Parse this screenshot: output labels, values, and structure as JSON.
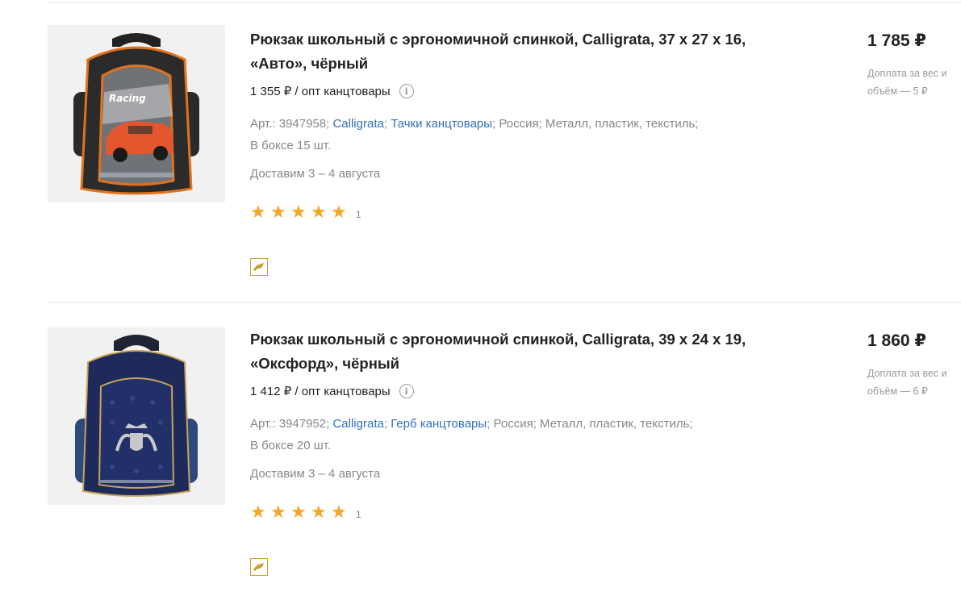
{
  "products": [
    {
      "title_line1": "Рюкзак школьный с эргономичной спинкой, Calligrata, 37 х 27 х 16,",
      "title_line2": "«Авто», чёрный",
      "wholesale": "1 355 ₽ / опт канцтовары",
      "info_icon": "i",
      "article": "Арт.: 3947958;",
      "brand": "Calligrata",
      "collection": "Тачки канцтовары",
      "country": "Россия;",
      "materials": "Металл, пластик, текстиль;",
      "box": "В боксе 15 шт.",
      "delivery": "Доставим 3 – 4 августа",
      "stars": "★★★★★",
      "rating_count": "1",
      "price": "1 785 ₽",
      "surcharge": "Доплата за вес и объём — 5 ₽",
      "image_icon": "racing-backpack-image",
      "brand_color": "#3370b8"
    },
    {
      "title_line1": "Рюкзак школьный с эргономичной спинкой, Calligrata, 39 х 24 х 19,",
      "title_line2": "«Оксфорд», чёрный",
      "wholesale": "1 412 ₽ / опт канцтовары",
      "info_icon": "i",
      "article": "Арт.: 3947952;",
      "brand": "Calligrata",
      "collection": "Герб канцтовары",
      "country": "Россия;",
      "materials": "Металл, пластик, текстиль;",
      "box": "В боксе 20 шт.",
      "delivery": "Доставим 3 – 4 августа",
      "stars": "★★★★★",
      "rating_count": "1",
      "price": "1 860 ₽",
      "surcharge": "Доплата за вес и объём — 6 ₽",
      "image_icon": "oxford-backpack-image"
    }
  ],
  "colors": {
    "star": "#f5a623",
    "link": "#3370b8",
    "muted": "#888888",
    "badge_border": "#c7a12e"
  }
}
